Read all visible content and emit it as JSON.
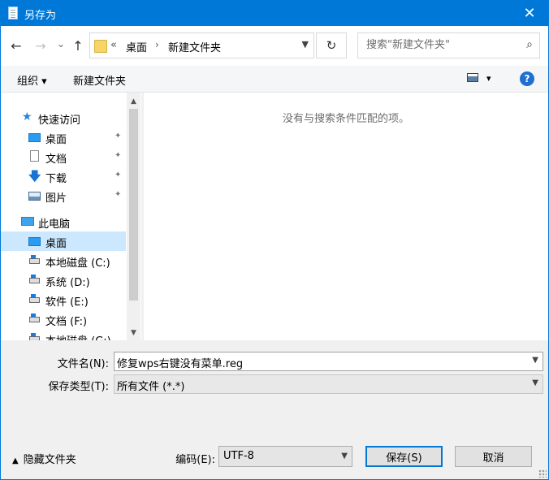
{
  "window": {
    "title": "另存为",
    "close_glyph": "✕"
  },
  "nav": {
    "back_glyph": "←",
    "forward_glyph": "→",
    "history_glyph": "⌄",
    "up_glyph": "↑",
    "breadcrumb": {
      "prefix": "«",
      "items": [
        "桌面",
        "新建文件夹"
      ],
      "separator": "›"
    },
    "refresh_glyph": "↻"
  },
  "search": {
    "placeholder": "搜索\"新建文件夹\"",
    "icon": "search-icon"
  },
  "toolbar": {
    "organize": "组织 ▾",
    "new_folder": "新建文件夹",
    "view_dropdown": "▾",
    "help": "?"
  },
  "sidebar": {
    "quick_access": "快速访问",
    "quick_items": [
      {
        "label": "桌面",
        "icon": "desktop-icon"
      },
      {
        "label": "文档",
        "icon": "document-icon"
      },
      {
        "label": "下载",
        "icon": "download-icon"
      },
      {
        "label": "图片",
        "icon": "pictures-icon"
      }
    ],
    "this_pc": "此电脑",
    "pc_items": [
      {
        "label": "桌面",
        "icon": "desktop-icon"
      },
      {
        "label": "本地磁盘 (C:)",
        "icon": "drive-icon"
      },
      {
        "label": "系统 (D:)",
        "icon": "drive-icon"
      },
      {
        "label": "软件 (E:)",
        "icon": "drive-icon"
      },
      {
        "label": "文档 (F:)",
        "icon": "drive-icon"
      },
      {
        "label": "本地磁盘 (G:)",
        "icon": "drive-icon"
      }
    ],
    "pin_glyph": "📌"
  },
  "file_list": {
    "empty_message": "没有与搜索条件匹配的项。"
  },
  "form": {
    "filename_label": "文件名(N):",
    "filename_value": "修复wps右键没有菜单.reg",
    "filetype_label": "保存类型(T):",
    "filetype_value": "所有文件  (*.*)",
    "encoding_label": "编码(E):",
    "encoding_value": "UTF-8",
    "save": "保存(S)",
    "cancel": "取消",
    "hide_folders": "隐藏文件夹"
  },
  "colors": {
    "accent": "#0078d7",
    "selection": "#cce8ff"
  }
}
